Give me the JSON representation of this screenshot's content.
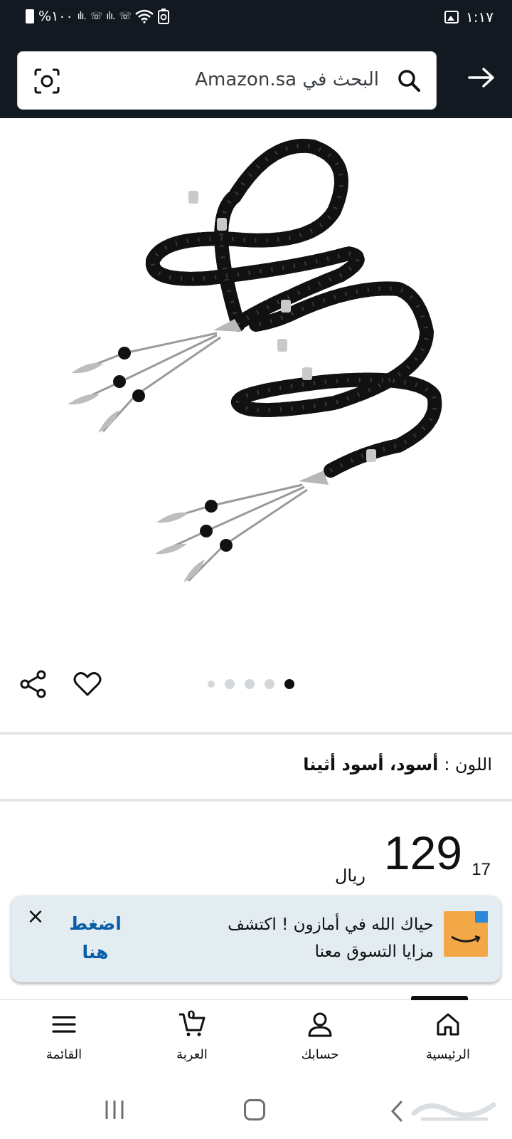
{
  "status_bar": {
    "time": "١:١٧",
    "battery": "%١٠٠",
    "network_icons": [
      "signal-icon",
      "wifi-calling-icon",
      "signal-icon",
      "wifi-calling-icon",
      "wifi-icon",
      "battery-saver-icon"
    ]
  },
  "search": {
    "placeholder": "البحث في Amazon.sa"
  },
  "product": {
    "image_alt_icon": "prayer-beads-image",
    "carousel": {
      "total": 5,
      "active_index": 4
    }
  },
  "color": {
    "label": "اللون :",
    "value": "أسود، أسود أثينا"
  },
  "price": {
    "whole": "129",
    "fraction": "17",
    "currency": "ريال"
  },
  "banner": {
    "message": "حياك الله في أمازون ! اكتشف مزايا التسوق معنا",
    "cta": "اضغط هنا",
    "close": "×"
  },
  "bottom_nav": {
    "home": "الرئيسية",
    "account": "حسابك",
    "cart": "العربة",
    "cart_count": "0",
    "menu": "القائمة"
  },
  "colors": {
    "header_bg": "#131921",
    "link_blue": "#0a5ea8",
    "banner_bg": "#e3edf1",
    "amazon_orange": "#f3a847"
  }
}
